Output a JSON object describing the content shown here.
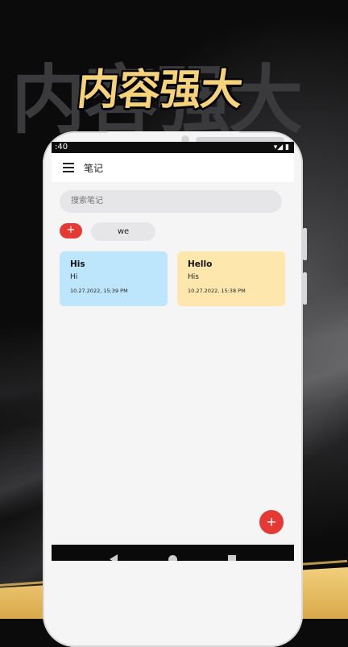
{
  "promo": {
    "background_text": "内容强大",
    "title": "内容强大",
    "accent_color": "#f6d27a"
  },
  "status_bar": {
    "time": ":40",
    "icons": "▾◢ ▮"
  },
  "app_bar": {
    "title": "笔记"
  },
  "search": {
    "placeholder": "搜索笔记"
  },
  "add_small_label": "+",
  "chips": [
    {
      "label": "we"
    }
  ],
  "notes": [
    {
      "title": "His",
      "body": "Hi",
      "date": "10.27.2022, 15:39 PM",
      "color": "#bde5fb"
    },
    {
      "title": "Hello",
      "body": "His",
      "date": "10.27.2022, 15:38 PM",
      "color": "#fde7ad"
    }
  ],
  "fab_label": "+",
  "accent_color": "#e53935"
}
